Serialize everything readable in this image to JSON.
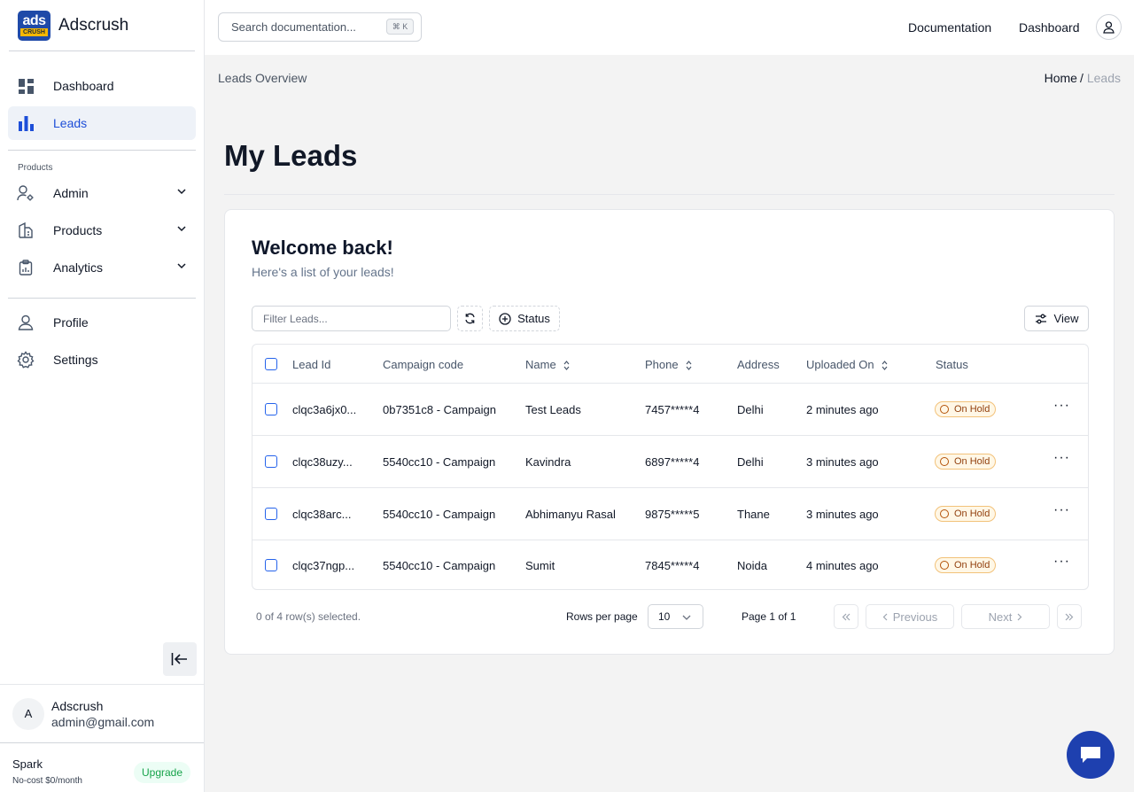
{
  "brand": {
    "logo_top": "ads",
    "logo_bottom": "CRUSH",
    "name": "Adscrush"
  },
  "sidebar": {
    "main_items": [
      {
        "label": "Dashboard",
        "icon": "dashboard-grid-icon"
      },
      {
        "label": "Leads",
        "icon": "bar-chart-icon",
        "active": true
      }
    ],
    "products_section_label": "Products",
    "product_items": [
      {
        "label": "Admin",
        "icon": "user-gear-icon"
      },
      {
        "label": "Products",
        "icon": "building-icon"
      },
      {
        "label": "Analytics",
        "icon": "clipboard-chart-icon"
      }
    ],
    "account_items": [
      {
        "label": "Profile",
        "icon": "user-icon"
      },
      {
        "label": "Settings",
        "icon": "gear-icon"
      }
    ],
    "user": {
      "initial": "A",
      "name": "Adscrush",
      "email": "admin@gmail.com"
    },
    "plan": {
      "name": "Spark",
      "description": "No-cost $0/month",
      "upgrade_label": "Upgrade"
    }
  },
  "topbar": {
    "search_placeholder": "Search documentation...",
    "shortcut": "⌘ K",
    "links": [
      "Documentation",
      "Dashboard"
    ]
  },
  "page": {
    "subtitle": "Leads Overview",
    "breadcrumb": {
      "home": "Home",
      "separator": "/",
      "current": "Leads"
    },
    "title": "My Leads"
  },
  "card": {
    "welcome": "Welcome back!",
    "subtitle": "Here's a list of your leads!",
    "filter_placeholder": "Filter Leads...",
    "status_button": "Status",
    "view_button": "View",
    "columns": [
      "Lead Id",
      "Campaign code",
      "Name",
      "Phone",
      "Address",
      "Uploaded On",
      "Status"
    ],
    "rows": [
      {
        "lead_id": "clqc3a6jx0...",
        "campaign": "0b7351c8 - Campaign",
        "name": "Test Leads",
        "phone": "7457*****4",
        "address": "Delhi",
        "uploaded": "2 minutes ago",
        "status": "On Hold"
      },
      {
        "lead_id": "clqc38uzy...",
        "campaign": "5540cc10 - Campaign",
        "name": "Kavindra",
        "phone": "6897*****4",
        "address": "Delhi",
        "uploaded": "3 minutes ago",
        "status": "On Hold"
      },
      {
        "lead_id": "clqc38arc...",
        "campaign": "5540cc10 - Campaign",
        "name": "Abhimanyu Rasal",
        "phone": "9875*****5",
        "address": "Thane",
        "uploaded": "3 minutes ago",
        "status": "On Hold"
      },
      {
        "lead_id": "clqc37ngp...",
        "campaign": "5540cc10 - Campaign",
        "name": "Sumit",
        "phone": "7845*****4",
        "address": "Noida",
        "uploaded": "4 minutes ago",
        "status": "On Hold"
      }
    ],
    "footer": {
      "selection": "0 of 4 row(s) selected.",
      "rows_per_page_label": "Rows per page",
      "rows_per_page_value": "10",
      "page_info": "Page 1 of 1",
      "previous": "Previous",
      "next": "Next"
    }
  },
  "colors": {
    "accent": "#1d4ed8",
    "status_on_hold": "#b45309",
    "upgrade": "#16a34a"
  }
}
